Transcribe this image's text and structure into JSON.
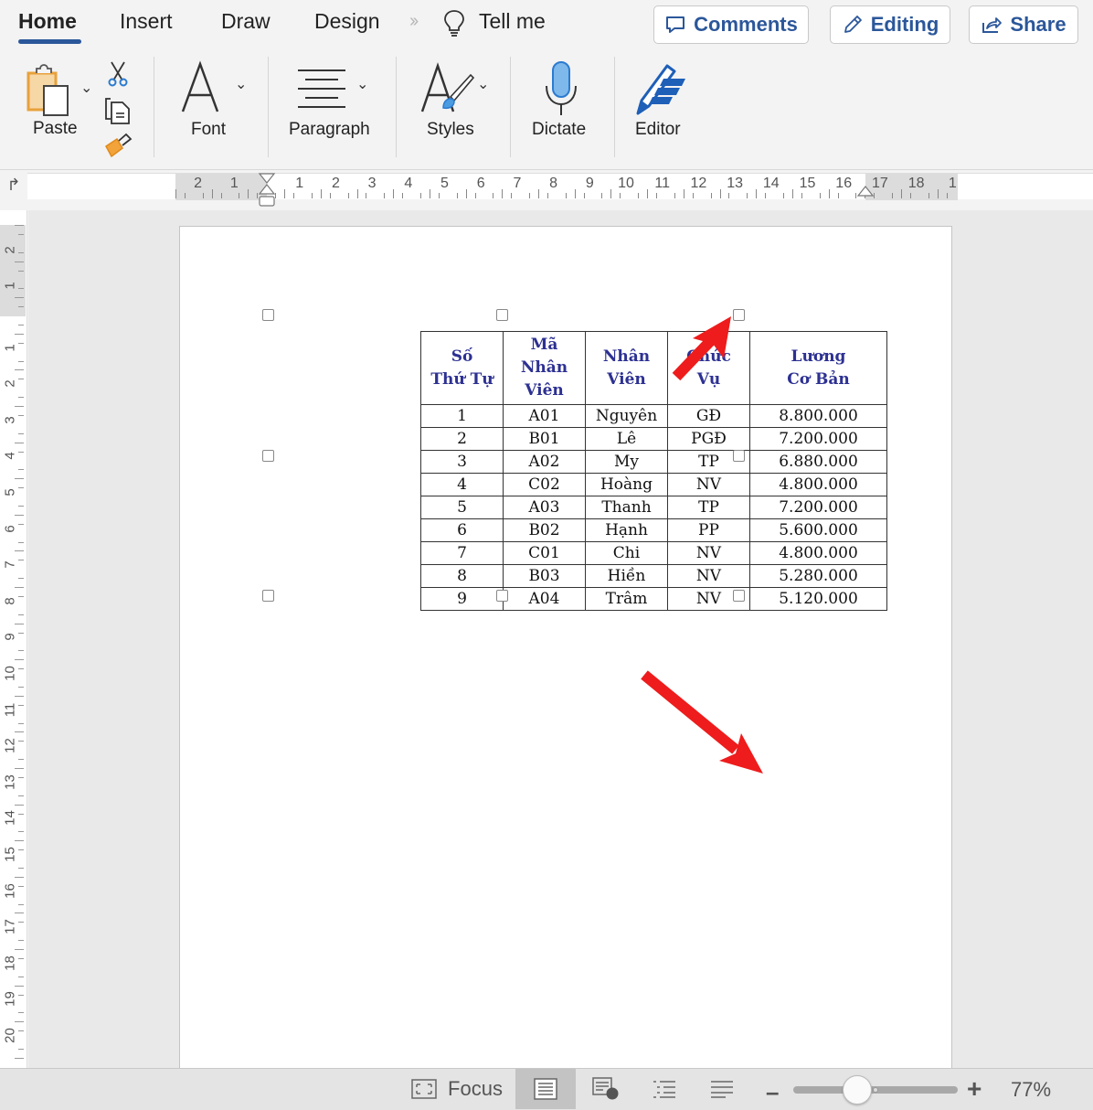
{
  "tabs": [
    {
      "label": "Home",
      "active": true
    },
    {
      "label": "Insert"
    },
    {
      "label": "Draw"
    },
    {
      "label": "Design"
    }
  ],
  "tell_me": "Tell me",
  "header_buttons": {
    "comments": "Comments",
    "editing": "Editing",
    "share": "Share"
  },
  "ribbon": {
    "paste": "Paste",
    "font": "Font",
    "paragraph": "Paragraph",
    "styles": "Styles",
    "dictate": "Dictate",
    "editor": "Editor"
  },
  "hruler_numbers": [
    "2",
    "1",
    "1",
    "2",
    "3",
    "4",
    "5",
    "6",
    "7",
    "8",
    "9",
    "10",
    "11",
    "12",
    "13",
    "14",
    "15",
    "16",
    "17",
    "18",
    "1"
  ],
  "vruler_numbers": [
    "2",
    "1",
    "1",
    "2",
    "3",
    "4",
    "5",
    "6",
    "7",
    "8",
    "9",
    "10",
    "11",
    "12",
    "13",
    "14",
    "15",
    "16",
    "17",
    "18",
    "19",
    "20"
  ],
  "table": {
    "headers": [
      [
        "Số",
        "Thứ Tự"
      ],
      [
        "Mã",
        "Nhân",
        "Viên"
      ],
      [
        "Nhân",
        "Viên"
      ],
      [
        "Chức",
        "Vụ"
      ],
      [
        "Lương",
        "Cơ Bản"
      ]
    ],
    "rows": [
      [
        "1",
        "A01",
        "Nguyên",
        "GĐ",
        "8.800.000"
      ],
      [
        "2",
        "B01",
        "Lê",
        "PGĐ",
        "7.200.000"
      ],
      [
        "3",
        "A02",
        "My",
        "TP",
        "6.880.000"
      ],
      [
        "4",
        "C02",
        "Hoàng",
        "NV",
        "4.800.000"
      ],
      [
        "5",
        "A03",
        "Thanh",
        "TP",
        "7.200.000"
      ],
      [
        "6",
        "B02",
        "Hạnh",
        "PP",
        "5.600.000"
      ],
      [
        "7",
        "C01",
        "Chi",
        "NV",
        "4.800.000"
      ],
      [
        "8",
        "B03",
        "Hiền",
        "NV",
        "5.280.000"
      ],
      [
        "9",
        "A04",
        "Trâm",
        "NV",
        "5.120.000"
      ]
    ]
  },
  "annotation_color": "#ee1c1c",
  "accent_color": "#2b579a",
  "statusbar": {
    "focus": "Focus",
    "zoom_percent": "77%",
    "zoom_value": 77
  }
}
